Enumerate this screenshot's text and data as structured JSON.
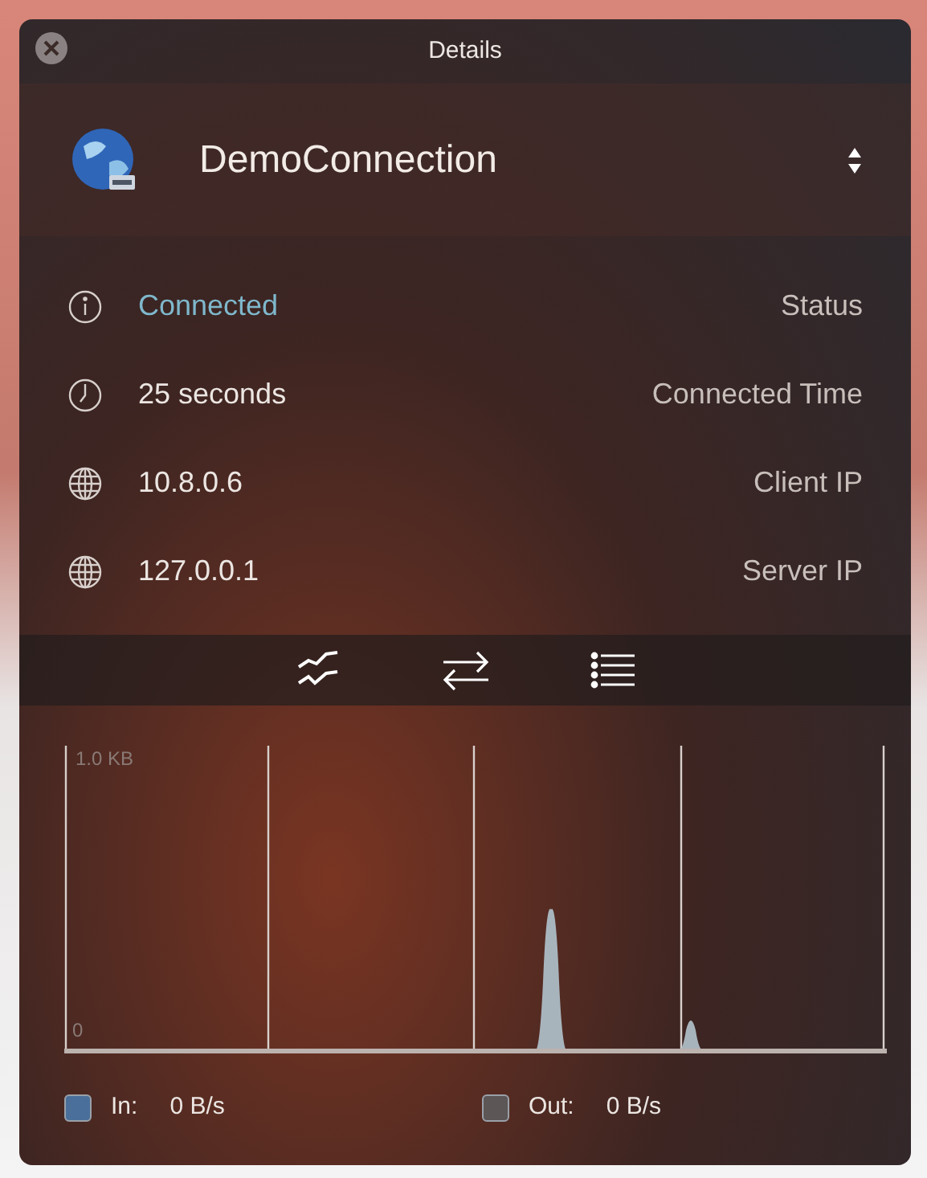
{
  "window": {
    "title": "Details"
  },
  "connection": {
    "name": "DemoConnection"
  },
  "info_rows": [
    {
      "kind": "info",
      "value": "Connected",
      "label": "Status",
      "highlight": true
    },
    {
      "kind": "clock",
      "value": "25 seconds",
      "label": "Connected Time",
      "highlight": false
    },
    {
      "kind": "globe",
      "value": "10.8.0.6",
      "label": "Client IP",
      "highlight": false
    },
    {
      "kind": "globe",
      "value": "127.0.0.1",
      "label": "Server IP",
      "highlight": false
    }
  ],
  "view_tabs": [
    {
      "kind": "graph"
    },
    {
      "kind": "transfer"
    },
    {
      "kind": "list"
    }
  ],
  "graph": {
    "top_label": "1.0 KB",
    "bottom_label": "0"
  },
  "legend": [
    {
      "label": "In:",
      "reading": "0 B/s",
      "color": "#4a6f9a"
    },
    {
      "label": "Out:",
      "reading": "0 B/s",
      "color": "#5c5656"
    }
  ]
}
